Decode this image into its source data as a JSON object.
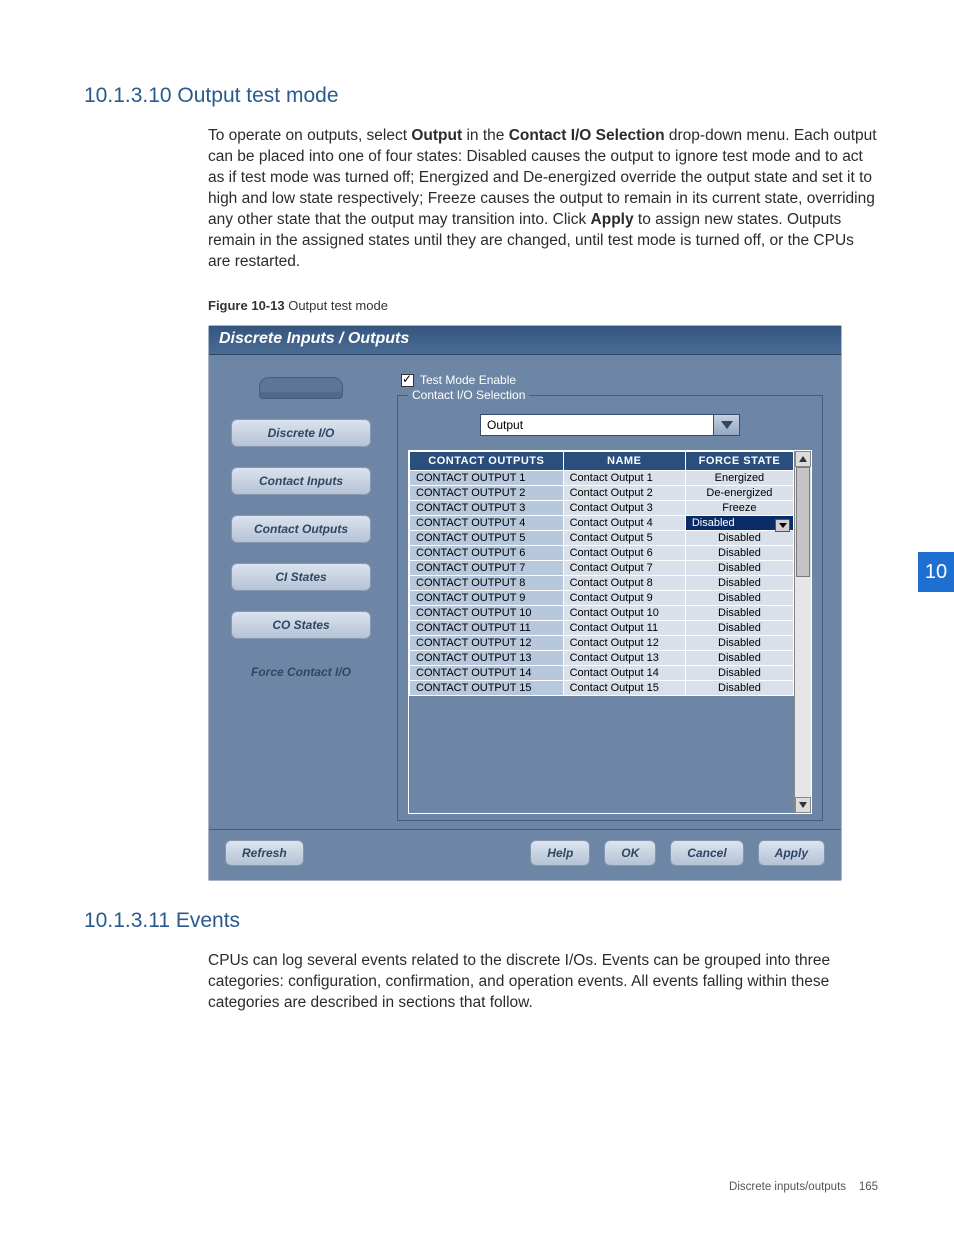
{
  "section1": {
    "heading": "10.1.3.10 Output test mode"
  },
  "para1": {
    "pre": "To operate on outputs, select ",
    "b1": "Output",
    "mid1": " in the ",
    "b2": "Contact I/O Selection",
    "mid2": " drop-down menu. Each output can be placed into one of four states: Disabled causes the output to ignore test mode and to act as if test mode was turned off; Energized and De-energized override the output state and set it to high and low state respectively; Freeze causes the output to remain in its current state, overriding any other state that the output may transition into. Click ",
    "b3": "Apply",
    "post": " to assign new states. Outputs remain in the assigned states until they are changed, until test mode is turned off, or the CPUs are restarted."
  },
  "figcap": {
    "bold": "Figure 10-13",
    "rest": "  Output test mode"
  },
  "ui": {
    "title": "Discrete Inputs / Outputs",
    "side": {
      "btn1": "Discrete I/O",
      "btn2": "Contact Inputs",
      "btn3": "Contact Outputs",
      "btn4": "CI States",
      "btn5": "CO States",
      "label": "Force Contact I/O"
    },
    "check_label": "Test Mode Enable",
    "fieldset_legend": "Contact I/O Selection",
    "dropdown_value": "Output",
    "headers": {
      "c1": "CONTACT OUTPUTS",
      "c2": "NAME",
      "c3": "FORCE STATE"
    },
    "rows": [
      {
        "id": "CONTACT OUTPUT 1",
        "name": "Contact Output 1",
        "state": "Energized",
        "sel": false
      },
      {
        "id": "CONTACT OUTPUT 2",
        "name": "Contact Output 2",
        "state": "De-energized",
        "sel": false
      },
      {
        "id": "CONTACT OUTPUT 3",
        "name": "Contact Output 3",
        "state": "Freeze",
        "sel": false
      },
      {
        "id": "CONTACT OUTPUT 4",
        "name": "Contact Output 4",
        "state": "Disabled",
        "sel": true
      },
      {
        "id": "CONTACT OUTPUT 5",
        "name": "Contact Output 5",
        "state": "Disabled",
        "sel": false
      },
      {
        "id": "CONTACT OUTPUT 6",
        "name": "Contact Output 6",
        "state": "Disabled",
        "sel": false
      },
      {
        "id": "CONTACT OUTPUT 7",
        "name": "Contact Output 7",
        "state": "Disabled",
        "sel": false
      },
      {
        "id": "CONTACT OUTPUT 8",
        "name": "Contact Output 8",
        "state": "Disabled",
        "sel": false
      },
      {
        "id": "CONTACT OUTPUT 9",
        "name": "Contact Output 9",
        "state": "Disabled",
        "sel": false
      },
      {
        "id": "CONTACT OUTPUT 10",
        "name": "Contact Output 10",
        "state": "Disabled",
        "sel": false
      },
      {
        "id": "CONTACT OUTPUT 11",
        "name": "Contact Output 11",
        "state": "Disabled",
        "sel": false
      },
      {
        "id": "CONTACT OUTPUT 12",
        "name": "Contact Output 12",
        "state": "Disabled",
        "sel": false
      },
      {
        "id": "CONTACT OUTPUT 13",
        "name": "Contact Output 13",
        "state": "Disabled",
        "sel": false
      },
      {
        "id": "CONTACT OUTPUT 14",
        "name": "Contact Output 14",
        "state": "Disabled",
        "sel": false
      },
      {
        "id": "CONTACT OUTPUT 15",
        "name": "Contact Output 15",
        "state": "Disabled",
        "sel": false
      }
    ],
    "footer": {
      "refresh": "Refresh",
      "help": "Help",
      "ok": "OK",
      "cancel": "Cancel",
      "apply": "Apply"
    }
  },
  "section2": {
    "heading": "10.1.3.11 Events"
  },
  "para2": "CPUs can log several events related to the discrete I/Os. Events can be grouped into three categories: configuration, confirmation, and operation events. All events falling within these categories are described in sections that follow.",
  "tab": "10",
  "footer": {
    "text": "Discrete inputs/outputs",
    "page": "165"
  }
}
